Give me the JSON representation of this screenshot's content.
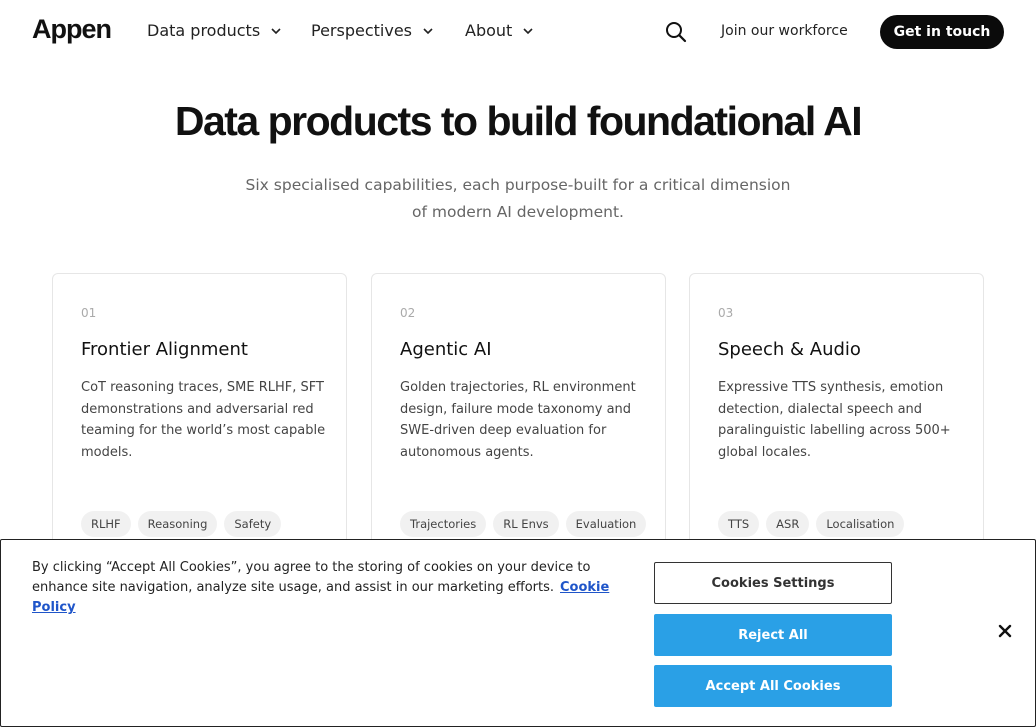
{
  "nav": {
    "logo": "Appen",
    "items": [
      {
        "label": "Data products"
      },
      {
        "label": "Perspectives"
      },
      {
        "label": "About"
      }
    ],
    "join_label": "Join our workforce",
    "cta_label": "Get in touch"
  },
  "hero": {
    "title": "Data products to build foundational AI",
    "subtitle_line1": "Six specialised capabilities, each purpose-built for a critical dimension",
    "subtitle_line2": "of modern AI development."
  },
  "cards": [
    {
      "number": "01",
      "title": "Frontier Alignment",
      "description": "CoT reasoning traces, SME RLHF, SFT demonstrations and adversarial red teaming for the world’s most capable models.",
      "tags": [
        "RLHF",
        "Reasoning",
        "Safety"
      ]
    },
    {
      "number": "02",
      "title": "Agentic AI",
      "description": "Golden trajectories, RL environment design, failure mode taxonomy and SWE-driven deep evaluation for autonomous agents.",
      "tags": [
        "Trajectories",
        "RL Envs",
        "Evaluation"
      ]
    },
    {
      "number": "03",
      "title": "Speech & Audio",
      "description": "Expressive TTS synthesis, emotion detection, dialectal speech and paralinguistic labelling across 500+ global locales.",
      "tags": [
        "TTS",
        "ASR",
        "Localisation"
      ]
    }
  ],
  "cookie": {
    "text": "By clicking “Accept All Cookies”, you agree to the storing of cookies on your device to enhance site navigation, analyze site usage, and assist in our marketing efforts.",
    "policy_link": "Cookie Policy",
    "settings_label": "Cookies Settings",
    "reject_label": "Reject All",
    "accept_label": "Accept All Cookies"
  },
  "colors": {
    "accent": "#2aa0e6",
    "cta_bg": "#0b0b0b",
    "link": "#1f55c9"
  },
  "icons": [
    "search-icon",
    "chevron-down-icon",
    "close-icon"
  ]
}
